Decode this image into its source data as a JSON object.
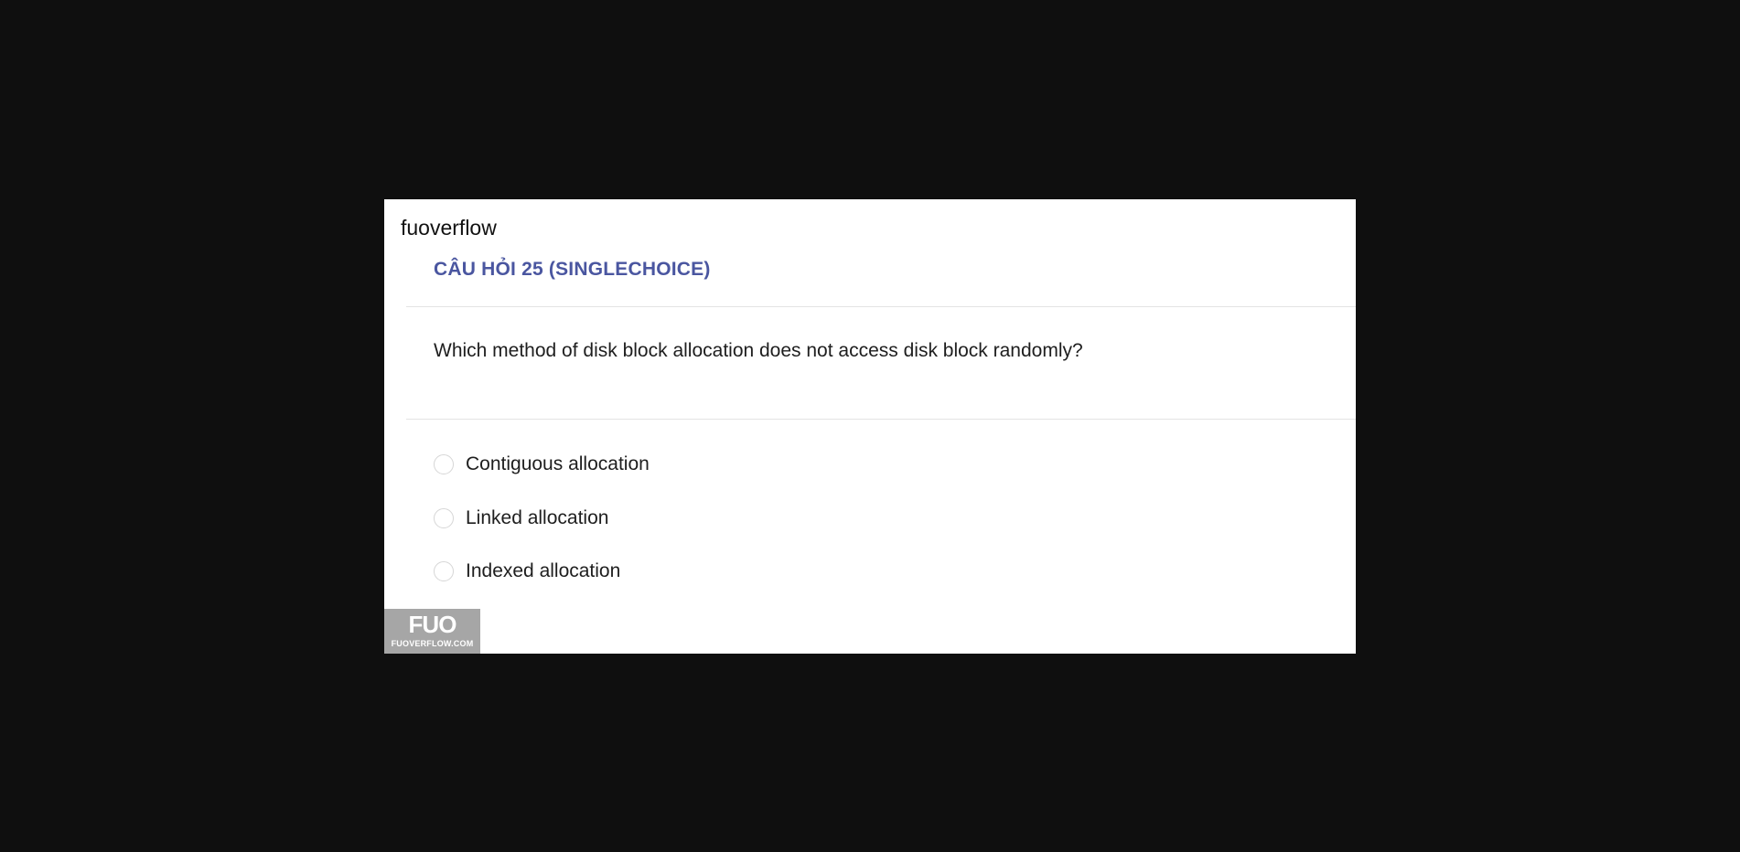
{
  "site": {
    "name": "fuoverflow"
  },
  "question": {
    "heading": "CÂU HỎI 25 (SINGLECHOICE)",
    "text": "Which method of disk block allocation does not access disk block randomly?",
    "options": [
      {
        "label": "Contiguous allocation"
      },
      {
        "label": "Linked allocation"
      },
      {
        "label": "Indexed allocation"
      }
    ]
  },
  "logo": {
    "mark": "FUO",
    "text": "FUOVERFLOW.COM"
  },
  "colors": {
    "background": "#0f0f0f",
    "card": "#ffffff",
    "heading": "#4a56a0",
    "logo_bg": "#a6a6a6"
  }
}
